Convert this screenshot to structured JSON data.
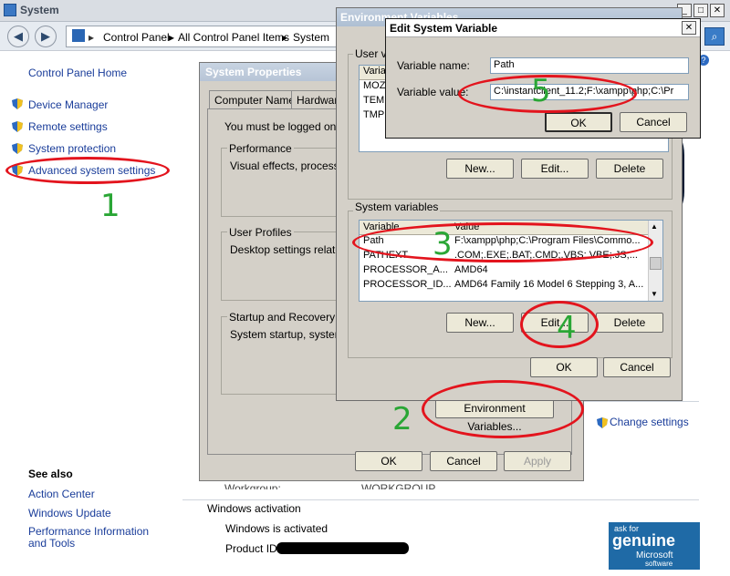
{
  "window": {
    "title": "System"
  },
  "address": {
    "crumbs": [
      "Control Panel",
      "All Control Panel Items",
      "System"
    ]
  },
  "left_pane": {
    "home": "Control Panel Home",
    "links": [
      "Device Manager",
      "Remote settings",
      "System protection",
      "Advanced system settings"
    ],
    "see_also_heading": "See also",
    "see_also": [
      "Action Center",
      "Windows Update",
      "Performance Information and Tools"
    ]
  },
  "main": {
    "change_settings": "Change settings",
    "workgroup_label": "Workgroup:",
    "workgroup_value": "WORKGROUP",
    "activation_heading": "Windows activation",
    "activation_status": "Windows is activated",
    "product_id_label": "Product ID:",
    "genuine": {
      "ask_for": "ask for",
      "genuine": "genuine",
      "brand": "Microsoft",
      "software": "software"
    }
  },
  "system_properties": {
    "title": "System Properties",
    "tabs": [
      "Computer Name",
      "Hardware"
    ],
    "logon_note": "You must be logged on as",
    "performance": {
      "label": "Performance",
      "desc": "Visual effects, processor"
    },
    "user_profiles": {
      "label": "User Profiles",
      "desc": "Desktop settings related"
    },
    "startup": {
      "label": "Startup and Recovery",
      "desc": "System startup, system fa"
    },
    "env_button": "Environment Variables...",
    "ok": "OK",
    "cancel": "Cancel",
    "apply": "Apply"
  },
  "env_vars": {
    "title": "Environment Variables",
    "user_group": "User va",
    "user_columns": [
      "Varia"
    ],
    "user_rows": [
      "MOZ",
      "TEMP",
      "TMP"
    ],
    "new_btn": "New...",
    "edit_btn": "Edit...",
    "delete_btn": "Delete",
    "system_group": "System variables",
    "system_columns": [
      "Variable",
      "Value"
    ],
    "system_rows": [
      {
        "name": "Path",
        "value": "F:\\xampp\\php;C:\\Program Files\\Commo..."
      },
      {
        "name": "PATHEXT",
        "value": ".COM;.EXE;.BAT;.CMD;.VBS;.VBE;.JS;..."
      },
      {
        "name": "PROCESSOR_A...",
        "value": "AMD64"
      },
      {
        "name": "PROCESSOR_ID...",
        "value": "AMD64 Family 16 Model 6 Stepping 3, A..."
      }
    ],
    "ok": "OK",
    "cancel": "Cancel"
  },
  "edit_var": {
    "title": "Edit System Variable",
    "name_label": "Variable name:",
    "name_value": "Path",
    "value_label": "Variable value:",
    "value_value": "C:\\instantclient_11.2;F:\\xampp\\php;C:\\Pr",
    "ok": "OK",
    "cancel": "Cancel"
  },
  "annotations": [
    "1",
    "2",
    "3",
    "4",
    "5"
  ],
  "colors": {
    "annotation_red": "#e3141d",
    "annotation_green": "#2aa635",
    "link_blue": "#1a3d9a"
  }
}
